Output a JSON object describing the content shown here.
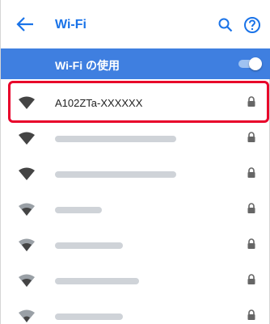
{
  "appbar": {
    "title": "Wi-Fi",
    "icons": [
      "back-arrow-icon",
      "search-icon",
      "help-icon"
    ]
  },
  "wifi_master": {
    "label": "Wi-Fi の使用",
    "enabled": true
  },
  "networks": [
    {
      "ssid": "A102ZTa-XXXXXX",
      "secured": true,
      "highlighted": true
    },
    {
      "ssid": "",
      "secured": true
    },
    {
      "ssid": "",
      "secured": true
    },
    {
      "ssid": "",
      "secured": true
    },
    {
      "ssid": "",
      "secured": true
    },
    {
      "ssid": "",
      "secured": true
    },
    {
      "ssid": "",
      "secured": true
    }
  ],
  "colors": {
    "accent": "#1a73e8",
    "master_bar": "#3f7fe0",
    "highlight_border": "#e8002a"
  }
}
